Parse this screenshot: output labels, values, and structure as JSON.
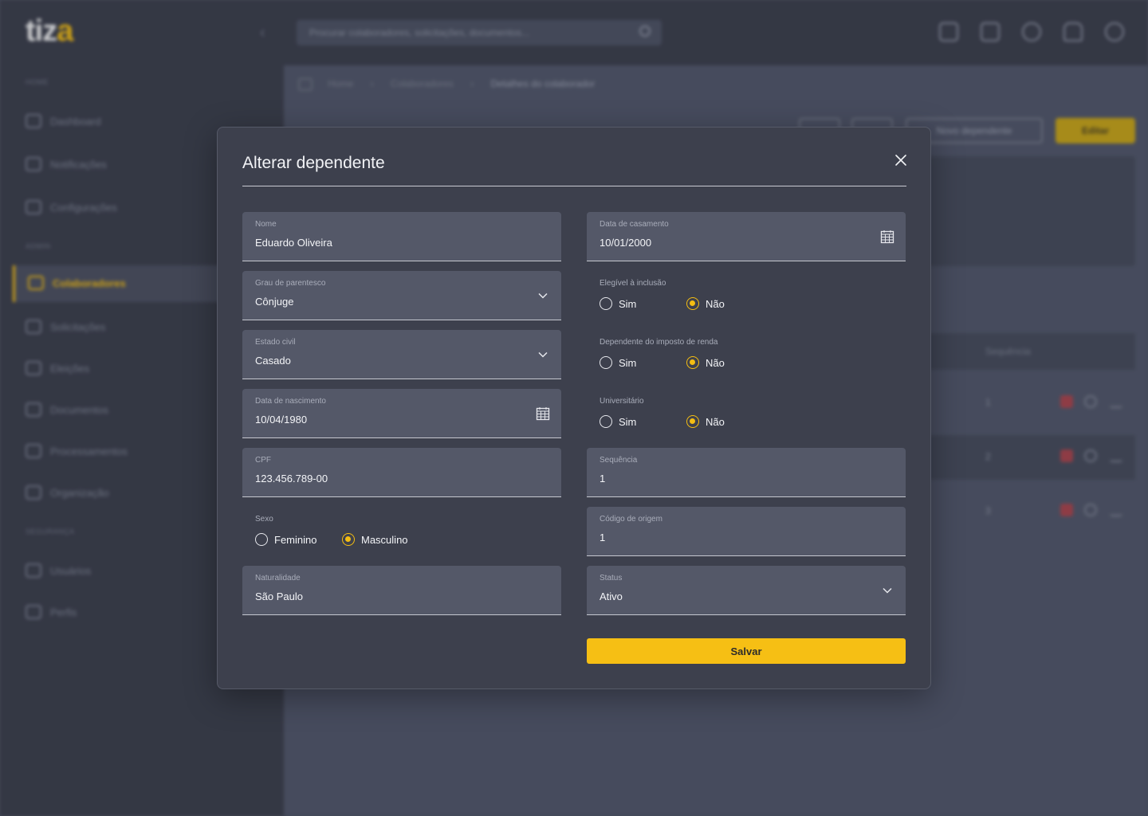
{
  "app": {
    "logo_main": "tiz",
    "logo_accent": "a",
    "search_placeholder": "Procurar colaboradores, solicitações, documentos..."
  },
  "sidebar": {
    "sections": [
      "HOME",
      "ADMIN",
      "SEGURANÇA"
    ],
    "items": [
      {
        "label": "Dashboard",
        "icon": "home-icon"
      },
      {
        "label": "Notificações",
        "icon": "bell-icon"
      },
      {
        "label": "Configurações",
        "icon": "gear-icon"
      },
      {
        "label": "Colaboradores",
        "icon": "users-icon",
        "active": true
      },
      {
        "label": "Solicitações",
        "icon": "requests-icon"
      },
      {
        "label": "Eleições",
        "icon": "ballot-icon"
      },
      {
        "label": "Documentos",
        "icon": "folder-icon"
      },
      {
        "label": "Processamentos",
        "icon": "server-icon"
      },
      {
        "label": "Organização",
        "icon": "building-icon"
      },
      {
        "label": "Usuários",
        "icon": "user-icon"
      },
      {
        "label": "Perfis",
        "icon": "id-card-icon"
      }
    ]
  },
  "breadcrumb": [
    "Home",
    "Colaboradores",
    "Detalhes do colaborador"
  ],
  "background": {
    "new_dependent_button": "Novo dependente",
    "edit_button": "Editar",
    "table_header_sequence": "Sequência",
    "rows": [
      "1",
      "2",
      "3"
    ]
  },
  "modal": {
    "title": "Alterar dependente",
    "left": {
      "nome": {
        "label": "Nome",
        "value": "Eduardo Oliveira"
      },
      "grau": {
        "label": "Grau de parentesco",
        "value": "Cônjuge"
      },
      "estado_civil": {
        "label": "Estado civil",
        "value": "Casado"
      },
      "nascimento": {
        "label": "Data de nascimento",
        "value": "10/04/1980"
      },
      "cpf": {
        "label": "CPF",
        "value": "123.456.789-00"
      },
      "sexo": {
        "label": "Sexo",
        "options": [
          "Feminino",
          "Masculino"
        ],
        "selected": "Masculino"
      },
      "naturalidade": {
        "label": "Naturalidade",
        "value": "São Paulo"
      }
    },
    "right": {
      "casamento": {
        "label": "Data de casamento",
        "value": "10/01/2000"
      },
      "elegivel": {
        "label": "Elegível à inclusão",
        "options": [
          "Sim",
          "Não"
        ],
        "selected": "Não"
      },
      "imposto": {
        "label": "Dependente do imposto de renda",
        "options": [
          "Sim",
          "Não"
        ],
        "selected": "Não"
      },
      "universitario": {
        "label": "Universitário",
        "options": [
          "Sim",
          "Não"
        ],
        "selected": "Não"
      },
      "sequencia": {
        "label": "Sequência",
        "value": "1"
      },
      "codigo_origem": {
        "label": "Código de origem",
        "value": "1"
      },
      "status": {
        "label": "Status",
        "value": "Ativo"
      }
    },
    "save_label": "Salvar"
  },
  "colors": {
    "accent": "#f6bf14",
    "modal_bg": "#3d404d",
    "field_bg": "#545868"
  }
}
